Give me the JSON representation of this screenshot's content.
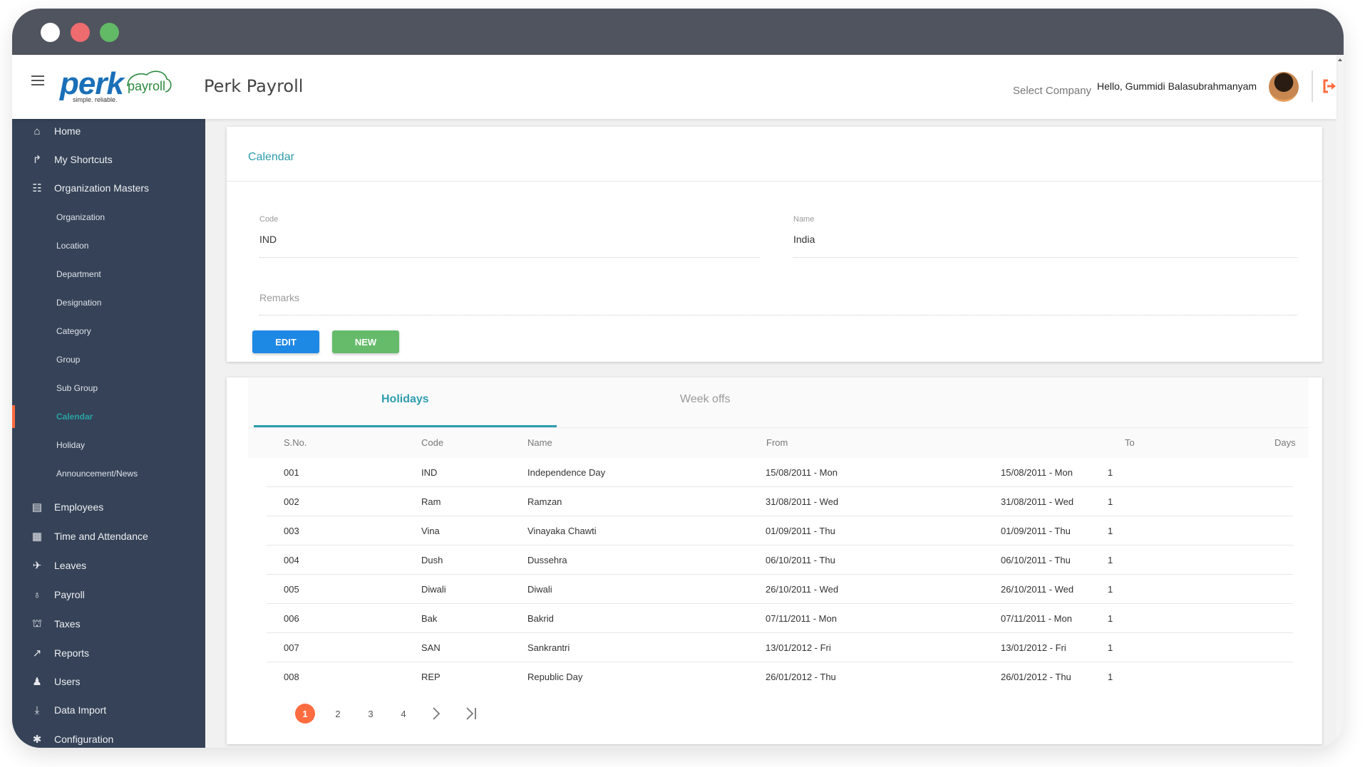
{
  "window": {
    "controls": [
      "close",
      "minimize",
      "maximize"
    ]
  },
  "header": {
    "logo_main": "perk",
    "logo_sub": "payroll",
    "logo_tagline": "simple. reliable.",
    "app_title": "Perk Payroll",
    "select_company": "Select Company",
    "greeting": "Hello, Gummidi Balasubrahmanyam",
    "accent_color": "#ff6a3d"
  },
  "sidebar": {
    "items": [
      {
        "label": "Home",
        "icon": "home-icon",
        "type": "main"
      },
      {
        "label": "My Shortcuts",
        "icon": "shortcut-icon",
        "type": "main"
      },
      {
        "label": "Organization Masters",
        "icon": "sitemap-icon",
        "type": "main"
      },
      {
        "label": "Organization",
        "type": "sub"
      },
      {
        "label": "Location",
        "type": "sub"
      },
      {
        "label": "Department",
        "type": "sub"
      },
      {
        "label": "Designation",
        "type": "sub"
      },
      {
        "label": "Category",
        "type": "sub"
      },
      {
        "label": "Group",
        "type": "sub"
      },
      {
        "label": "Sub Group",
        "type": "sub"
      },
      {
        "label": "Calendar",
        "type": "sub",
        "active": true
      },
      {
        "label": "Holiday",
        "type": "sub"
      },
      {
        "label": "Announcement/News",
        "type": "sub"
      },
      {
        "label": "Employees",
        "icon": "id-card-icon",
        "type": "main"
      },
      {
        "label": "Time and Attendance",
        "icon": "calendar-icon",
        "type": "main"
      },
      {
        "label": "Leaves",
        "icon": "plane-icon",
        "type": "main"
      },
      {
        "label": "Payroll",
        "icon": "money-bag-icon",
        "type": "main"
      },
      {
        "label": "Taxes",
        "icon": "bank-icon",
        "type": "main"
      },
      {
        "label": "Reports",
        "icon": "line-chart-icon",
        "type": "main"
      },
      {
        "label": "Users",
        "icon": "user-icon",
        "type": "main"
      },
      {
        "label": "Data Import",
        "icon": "download-icon",
        "type": "main"
      },
      {
        "label": "Configuration",
        "icon": "gear-icon",
        "type": "main"
      }
    ]
  },
  "form": {
    "title": "Calendar",
    "code_label": "Code",
    "code_value": "IND",
    "name_label": "Name",
    "name_value": "India",
    "remarks_placeholder": "Remarks",
    "edit_label": "EDIT",
    "new_label": "NEW"
  },
  "tabs": {
    "holidays": "Holidays",
    "weekoffs": "Week offs",
    "active": "Holidays"
  },
  "table": {
    "columns": [
      "S.No.",
      "Code",
      "Name",
      "From",
      "To",
      "Days"
    ],
    "rows": [
      [
        "001",
        "IND",
        "Independence Day",
        "15/08/2011 - Mon",
        "15/08/2011 - Mon",
        "1"
      ],
      [
        "002",
        "Ram",
        "Ramzan",
        "31/08/2011 - Wed",
        "31/08/2011 - Wed",
        "1"
      ],
      [
        "003",
        "Vina",
        "Vinayaka Chawti",
        "01/09/2011 - Thu",
        "01/09/2011 - Thu",
        "1"
      ],
      [
        "004",
        "Dush",
        "Dussehra",
        "06/10/2011 - Thu",
        "06/10/2011 - Thu",
        "1"
      ],
      [
        "005",
        "Diwali",
        "Diwali",
        "26/10/2011 - Wed",
        "26/10/2011 - Wed",
        "1"
      ],
      [
        "006",
        "Bak",
        "Bakrid",
        "07/11/2011 - Mon",
        "07/11/2011 - Mon",
        "1"
      ],
      [
        "007",
        "SAN",
        "Sankrantri",
        "13/01/2012 - Fri",
        "13/01/2012 - Fri",
        "1"
      ],
      [
        "008",
        "REP",
        "Republic Day",
        "26/01/2012 - Thu",
        "26/01/2012 - Thu",
        "1"
      ]
    ]
  },
  "pagination": {
    "pages": [
      "1",
      "2",
      "3",
      "4"
    ],
    "current": "1",
    "next": "›",
    "last": ">|"
  }
}
